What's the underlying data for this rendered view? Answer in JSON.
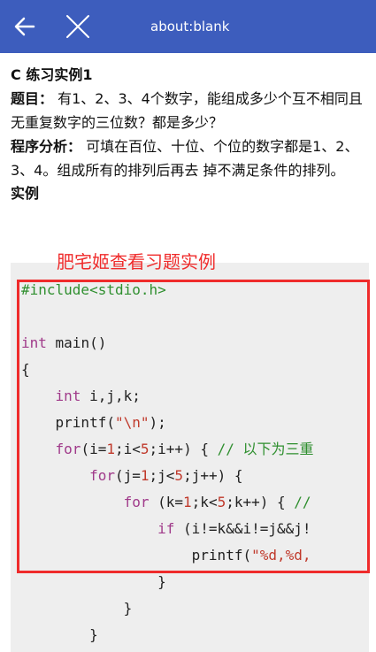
{
  "appbar": {
    "title": "about:blank",
    "back_icon": "arrow-left-icon",
    "close_icon": "close-icon",
    "color": "#3d5dbd"
  },
  "article": {
    "heading": "C 练习实例1",
    "problem_label": "题目：",
    "problem_text": " 有1、2、3、4个数字，能组成多少个互不相同且无重复数字的三位数？都是多少？",
    "analysis_label": "程序分析：",
    "analysis_text": " 可填在百位、十位、个位的数字都是1、2、3、4。组成所有的排列后再去 掉不满足条件的排列。",
    "example_heading": "实例"
  },
  "annotation": {
    "label": "肥宅姬查看习题实例",
    "color": "#ef2b2b"
  },
  "code": {
    "l1_inc": "#include",
    "l1_hdr": "<stdio.h>",
    "l3_kw": "int",
    "l3_rest": " main()",
    "l4": "{",
    "l5_kw": "int",
    "l5_rest": " i,j,k;",
    "l6_fn": "printf(",
    "l6_str": "\"\\n\"",
    "l6_end": ");",
    "l7_kw": "for",
    "l7_a": "(i=",
    "l7_n1": "1",
    "l7_b": ";i<",
    "l7_n2": "5",
    "l7_c": ";i++) { ",
    "l7_cmt": "// 以下为三重",
    "l8_kw": "for",
    "l8_a": "(j=",
    "l8_n1": "1",
    "l8_b": ";j<",
    "l8_n2": "5",
    "l8_c": ";j++) {",
    "l9_kw": "for",
    "l9_a": " (k=",
    "l9_n1": "1",
    "l9_b": ";k<",
    "l9_n2": "5",
    "l9_c": ";k++) { ",
    "l9_cmt": "//",
    "l10_kw": "if",
    "l10_rest": " (i!=k&&i!=j&&j!",
    "l11_fn": "printf(",
    "l11_str": "\"%d,%d,",
    "l12": "}",
    "l13": "}",
    "l14": "}"
  }
}
